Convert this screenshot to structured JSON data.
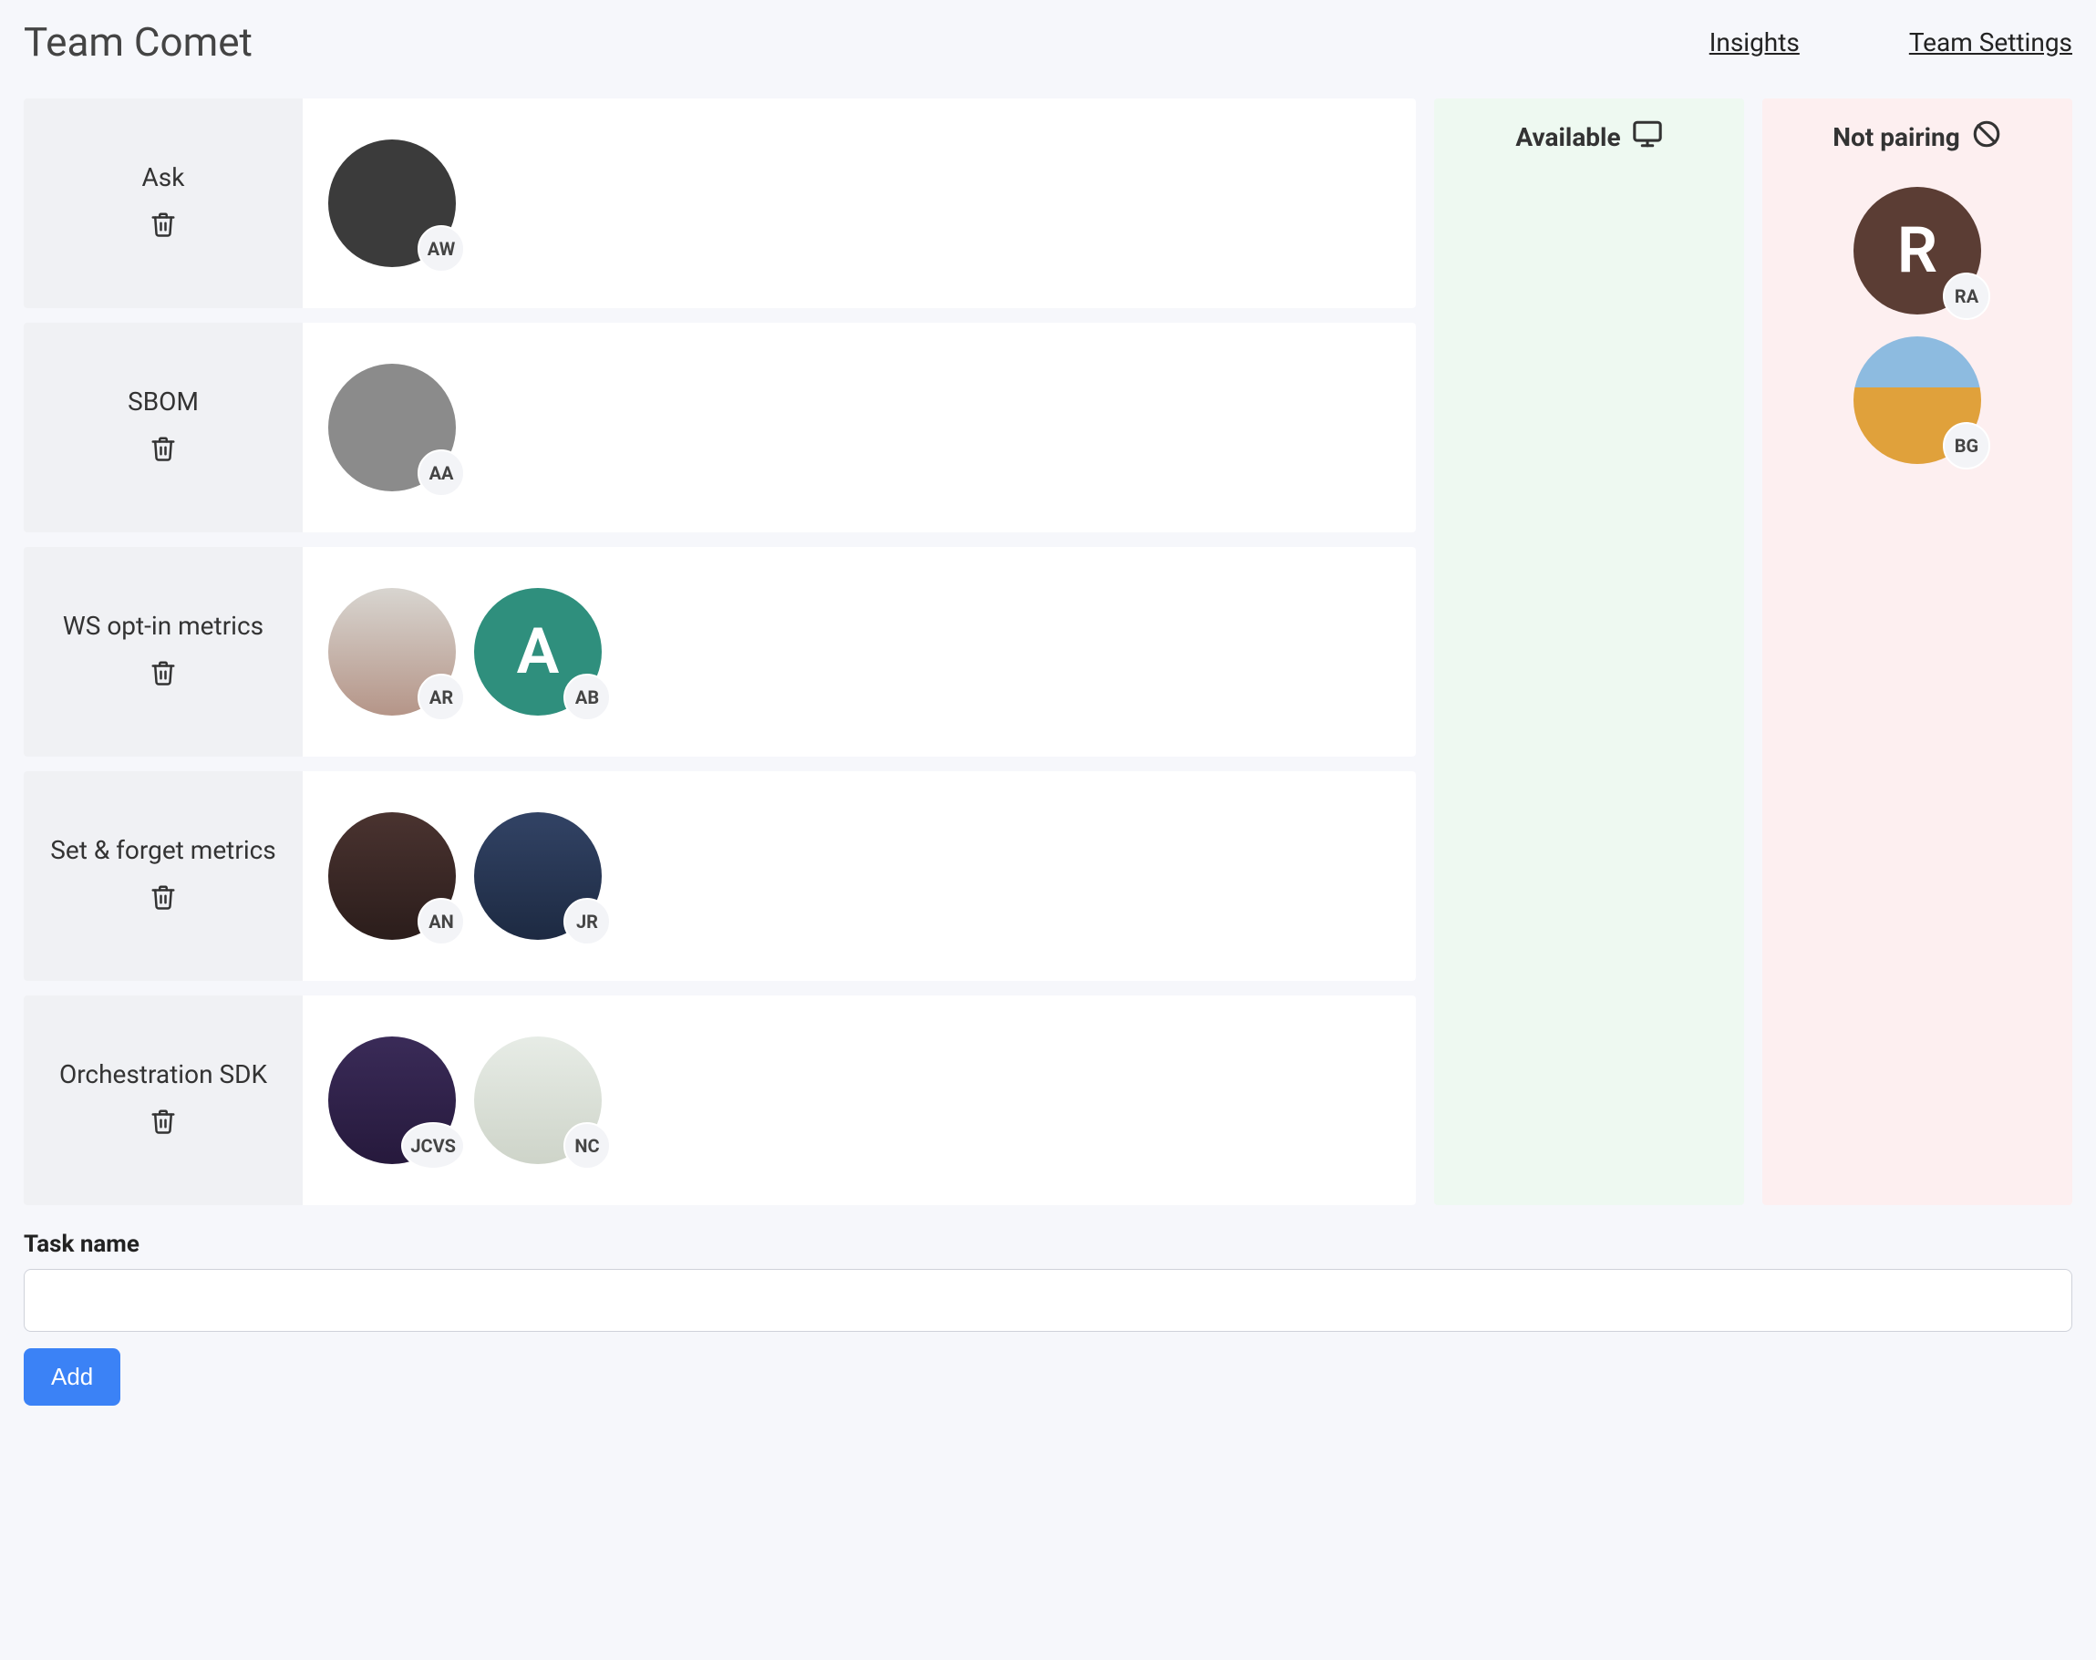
{
  "header": {
    "title": "Team Comet",
    "links": {
      "insights": "Insights",
      "settings": "Team Settings"
    }
  },
  "tasks": [
    {
      "name": "Ask",
      "people": [
        {
          "initials": "AW",
          "avatar_class": "photo1"
        }
      ]
    },
    {
      "name": "SBOM",
      "people": [
        {
          "initials": "AA",
          "avatar_class": "photo2"
        }
      ]
    },
    {
      "name": "WS opt-in metrics",
      "people": [
        {
          "initials": "AR",
          "avatar_class": "photo3"
        },
        {
          "initials": "AB",
          "avatar_class": "letter-A",
          "letter": "A"
        }
      ]
    },
    {
      "name": "Set & forget metrics",
      "people": [
        {
          "initials": "AN",
          "avatar_class": "photo4"
        },
        {
          "initials": "JR",
          "avatar_class": "photo5"
        }
      ]
    },
    {
      "name": "Orchestration SDK",
      "people": [
        {
          "initials": "JCVS",
          "avatar_class": "photo6"
        },
        {
          "initials": "NC",
          "avatar_class": "photo7"
        }
      ]
    }
  ],
  "columns": {
    "available": {
      "title": "Available",
      "people": []
    },
    "not_pairing": {
      "title": "Not pairing",
      "people": [
        {
          "initials": "RA",
          "avatar_class": "letter-R",
          "letter": "R"
        },
        {
          "initials": "BG",
          "avatar_class": "photo8"
        }
      ]
    }
  },
  "form": {
    "label": "Task name",
    "value": "",
    "button": "Add"
  }
}
